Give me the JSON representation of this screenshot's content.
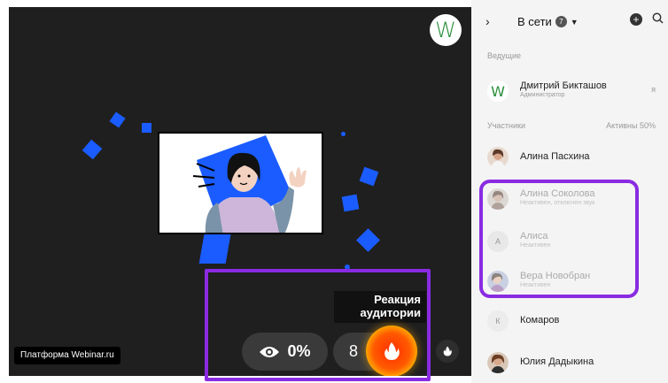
{
  "stage": {
    "host_avatar_letter": "W",
    "brand_label": "Платформа Webinar.ru",
    "reaction_label_line1": "Реакция",
    "reaction_label_line2": "аудитории",
    "viewers_percent": "0%",
    "reaction_count": "8"
  },
  "sidebar": {
    "title": "В сети",
    "online_count": "7",
    "hosts_label": "Ведущие",
    "participants_label": "Участники",
    "active_label": "Активны 50%",
    "hosts": [
      {
        "name": "Дмитрий Бикташов",
        "role": "Администратор",
        "avatar_letter": "W",
        "self_mark": "я"
      }
    ],
    "participants": [
      {
        "name": "Алина Пасхина",
        "status": ""
      },
      {
        "name": "Алина Соколова",
        "status": "Неактивен, отключен звук"
      },
      {
        "name": "Алиса",
        "status": "Неактивен",
        "avatar_letter": "А"
      },
      {
        "name": "Вера Новобран",
        "status": "Неактивен"
      },
      {
        "name": "Комаров",
        "status": "",
        "avatar_letter": "К"
      },
      {
        "name": "Юлия Дадыкина",
        "status": ""
      }
    ]
  },
  "colors": {
    "accent_blue": "#1a5cff",
    "highlight_purple": "#8a2be2",
    "fire_orange": "#ff5a00",
    "stage_bg": "#1f1f1f"
  },
  "icons": [
    "chevron-right-icon",
    "caret-down-icon",
    "add-icon",
    "search-icon",
    "eye-icon",
    "flame-icon"
  ]
}
